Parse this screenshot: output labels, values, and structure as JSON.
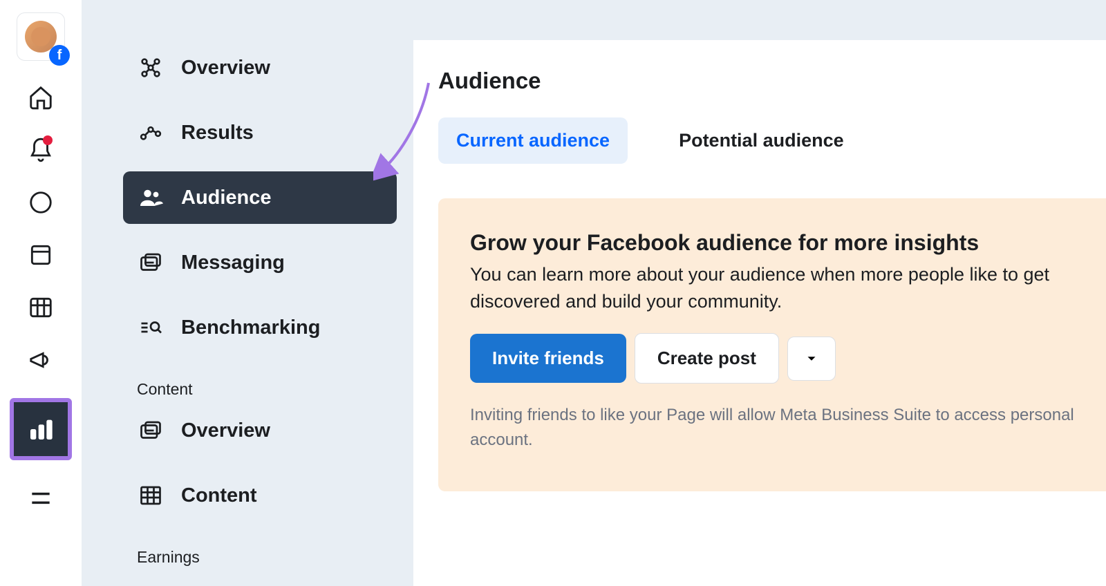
{
  "rail": {
    "fb_glyph": "f"
  },
  "nav": {
    "items": [
      {
        "label": "Overview"
      },
      {
        "label": "Results"
      },
      {
        "label": "Audience"
      },
      {
        "label": "Messaging"
      },
      {
        "label": "Benchmarking"
      }
    ],
    "content_section": "Content",
    "content_items": [
      {
        "label": "Overview"
      },
      {
        "label": "Content"
      }
    ],
    "earnings_section": "Earnings"
  },
  "main": {
    "page_title": "Audience",
    "tabs": [
      {
        "label": "Current audience"
      },
      {
        "label": "Potential audience"
      }
    ],
    "grow": {
      "title": "Grow your Facebook audience for more insights",
      "body": "You can learn more about your audience when more people like to get discovered and build your community.",
      "invite_label": "Invite friends",
      "create_label": "Create post",
      "note": "Inviting friends to like your Page will allow Meta Business Suite to access personal account."
    }
  }
}
